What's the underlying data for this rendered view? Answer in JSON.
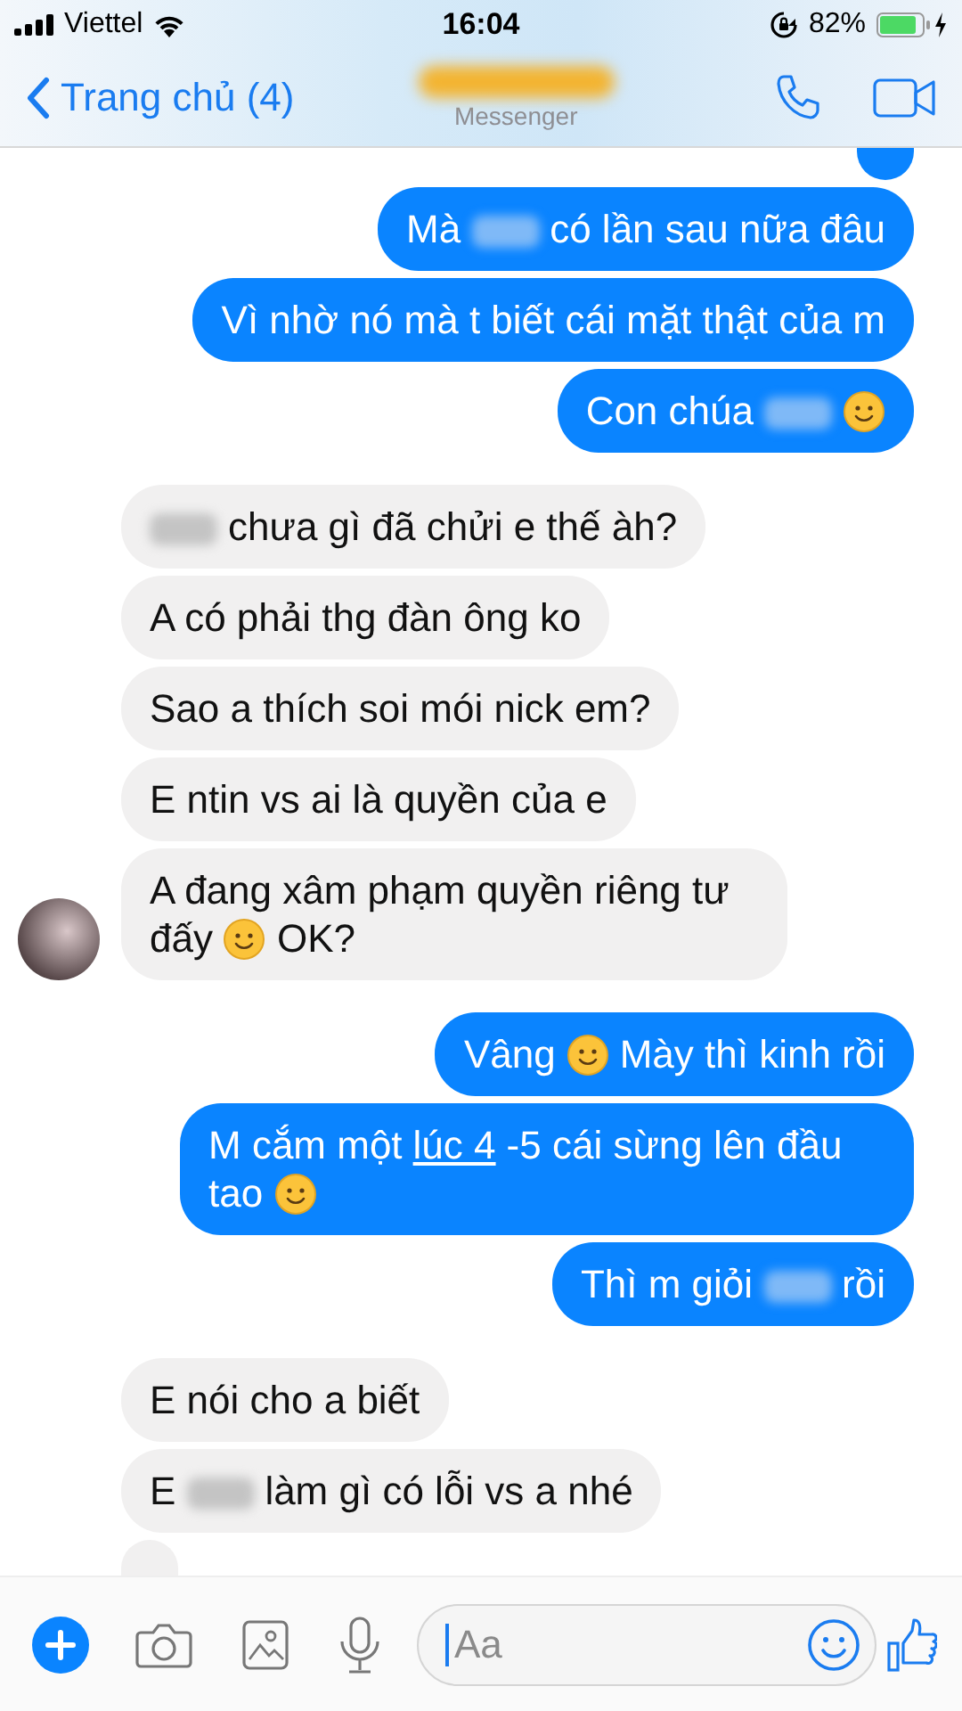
{
  "status_bar": {
    "carrier": "Viettel",
    "time": "16:04",
    "battery": "82%"
  },
  "header": {
    "back_label": "Trang chủ (4)",
    "subtitle": "Messenger"
  },
  "messages": [
    {
      "outgoing": true
    },
    {
      "outgoing": true,
      "parts": [
        {
          "kind": "text",
          "text": "Mà"
        },
        {
          "kind": "blur"
        },
        {
          "kind": "text",
          "text": "có lần sau nữa đâu"
        }
      ]
    },
    {
      "outgoing": true,
      "parts": [
        {
          "kind": "text",
          "text": "Vì nhờ nó mà t biết cái mặt thật của m"
        }
      ]
    },
    {
      "outgoing": true,
      "parts": [
        {
          "kind": "text",
          "text": "Con chúa"
        },
        {
          "kind": "blur"
        },
        {
          "kind": "emoji"
        }
      ]
    },
    {
      "outgoing": false,
      "parts": [
        {
          "kind": "blur"
        },
        {
          "kind": "text",
          "text": "chưa gì đã chửi e thế àh?"
        }
      ]
    },
    {
      "outgoing": false,
      "parts": [
        {
          "kind": "text",
          "text": "A có phải thg đàn ông ko"
        }
      ]
    },
    {
      "outgoing": false,
      "parts": [
        {
          "kind": "text",
          "text": "Sao a thích soi mói nick em?"
        }
      ]
    },
    {
      "outgoing": false,
      "parts": [
        {
          "kind": "text",
          "text": "E ntin vs ai là quyền của e"
        }
      ]
    },
    {
      "outgoing": false,
      "avatar": true,
      "parts": [
        {
          "kind": "text",
          "text": "A đang xâm phạm quyền riêng tư"
        },
        {
          "kind": "text",
          "text": "đấy"
        },
        {
          "kind": "emoji"
        },
        {
          "kind": "text",
          "text": "OK?"
        }
      ]
    },
    {
      "outgoing": true,
      "parts": [
        {
          "kind": "text",
          "text": "Vâng"
        },
        {
          "kind": "emoji"
        },
        {
          "kind": "text",
          "text": "Mày thì kinh rồi"
        }
      ]
    },
    {
      "outgoing": true,
      "parts": [
        {
          "kind": "text",
          "text": "M cắm một"
        },
        {
          "kind": "link",
          "text": "lúc 4"
        },
        {
          "kind": "text",
          "text": "-5 cái sừng lên đầu"
        },
        {
          "kind": "text",
          "text": "tao"
        },
        {
          "kind": "emoji"
        }
      ]
    },
    {
      "outgoing": true,
      "parts": [
        {
          "kind": "text",
          "text": "Thì m giỏi"
        },
        {
          "kind": "blur"
        },
        {
          "kind": "text",
          "text": "rồi"
        }
      ]
    },
    {
      "outgoing": false,
      "parts": [
        {
          "kind": "text",
          "text": "E nói cho a biết"
        }
      ]
    },
    {
      "outgoing": false,
      "parts": [
        {
          "kind": "text",
          "text": "E"
        },
        {
          "kind": "blur"
        },
        {
          "kind": "text",
          "text": "làm gì có lỗi vs a nhé"
        }
      ]
    },
    {
      "outgoing": false
    }
  ],
  "composer": {
    "placeholder": "Aa"
  }
}
